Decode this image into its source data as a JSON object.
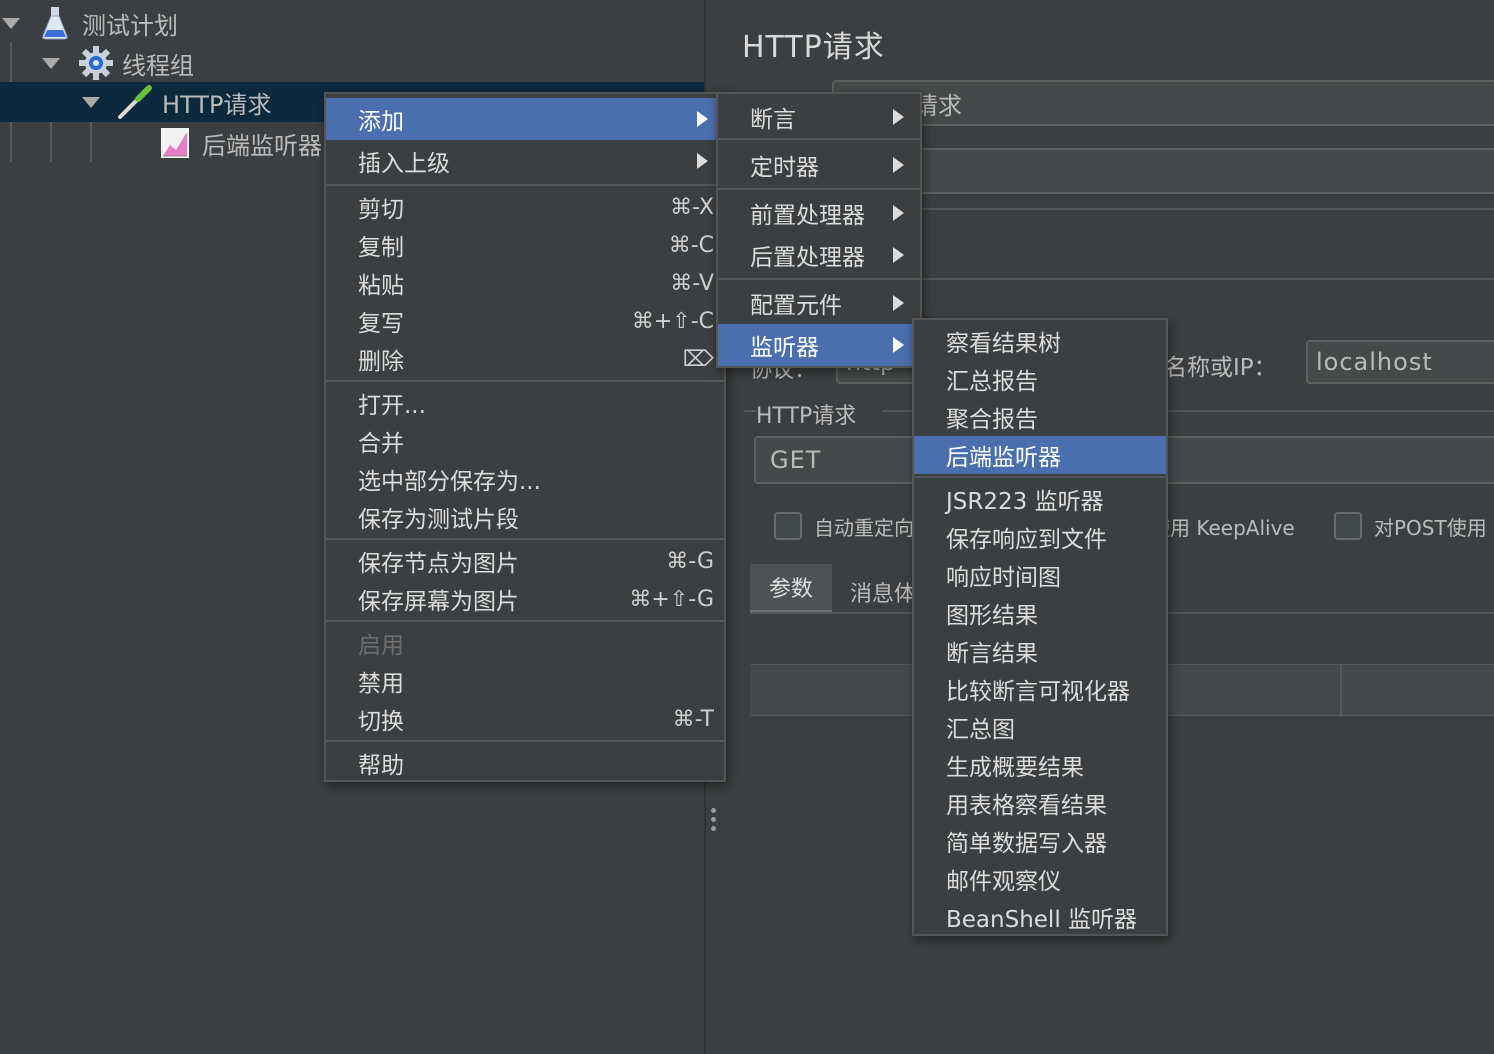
{
  "tree": {
    "items": [
      {
        "label": "测试计划",
        "icon": "flask-icon"
      },
      {
        "label": "线程组",
        "icon": "gear-icon"
      },
      {
        "label": "HTTP请求",
        "icon": "pipette-icon"
      },
      {
        "label": "后端监听器",
        "icon": "chart-icon"
      }
    ]
  },
  "right": {
    "title": "HTTP请求",
    "name_value_fragment": "请求",
    "host_label_fragment": "名称或IP：",
    "host_value": "localhost",
    "protocol_label_fragment": "协议：",
    "protocol_value_fragment": "http",
    "section_label": "HTTP请求",
    "method_value": "GET",
    "checkbox_redirect_label": "自动重定向",
    "checkbox_keepalive_label": "使用 KeepAlive",
    "checkbox_post_label": "对POST使用",
    "tab_params": "参数",
    "tab_body": "消息体"
  },
  "context_menu": {
    "items": [
      {
        "label": "添加",
        "shortcut": "",
        "submenu": true,
        "highlighted": true
      },
      {
        "label": "插入上级",
        "shortcut": "",
        "submenu": true
      },
      {
        "label": "剪切",
        "shortcut": "⌘-X"
      },
      {
        "label": "复制",
        "shortcut": "⌘-C"
      },
      {
        "label": "粘贴",
        "shortcut": "⌘-V"
      },
      {
        "label": "复写",
        "shortcut": "⌘+⇧-C"
      },
      {
        "label": "删除",
        "shortcut": "⌦"
      },
      {
        "label": "打开...",
        "shortcut": ""
      },
      {
        "label": "合并",
        "shortcut": ""
      },
      {
        "label": "选中部分保存为...",
        "shortcut": ""
      },
      {
        "label": "保存为测试片段",
        "shortcut": ""
      },
      {
        "label": "保存节点为图片",
        "shortcut": "⌘-G"
      },
      {
        "label": "保存屏幕为图片",
        "shortcut": "⌘+⇧-G"
      },
      {
        "label": "启用",
        "shortcut": "",
        "disabled": true
      },
      {
        "label": "禁用",
        "shortcut": ""
      },
      {
        "label": "切换",
        "shortcut": "⌘-T"
      },
      {
        "label": "帮助",
        "shortcut": ""
      }
    ]
  },
  "add_submenu": {
    "items": [
      {
        "label": "断言",
        "submenu": true
      },
      {
        "label": "定时器",
        "submenu": true
      },
      {
        "label": "前置处理器",
        "submenu": true
      },
      {
        "label": "后置处理器",
        "submenu": true
      },
      {
        "label": "配置元件",
        "submenu": true
      },
      {
        "label": "监听器",
        "submenu": true,
        "highlighted": true
      }
    ]
  },
  "listener_submenu": {
    "items": [
      {
        "label": "察看结果树"
      },
      {
        "label": "汇总报告"
      },
      {
        "label": "聚合报告"
      },
      {
        "label": "后端监听器",
        "highlighted": true
      },
      {
        "label": "JSR223 监听器"
      },
      {
        "label": "保存响应到文件"
      },
      {
        "label": "响应时间图"
      },
      {
        "label": "图形结果"
      },
      {
        "label": "断言结果"
      },
      {
        "label": "比较断言可视化器"
      },
      {
        "label": "汇总图"
      },
      {
        "label": "生成概要结果"
      },
      {
        "label": "用表格察看结果"
      },
      {
        "label": "简单数据写入器"
      },
      {
        "label": "邮件观察仪"
      },
      {
        "label": "BeanShell 监听器"
      }
    ]
  },
  "colors": {
    "background": "#3c3f41",
    "highlight": "#4b6eaf",
    "tree_selection": "#0d293e",
    "text": "#bbbbbb"
  }
}
